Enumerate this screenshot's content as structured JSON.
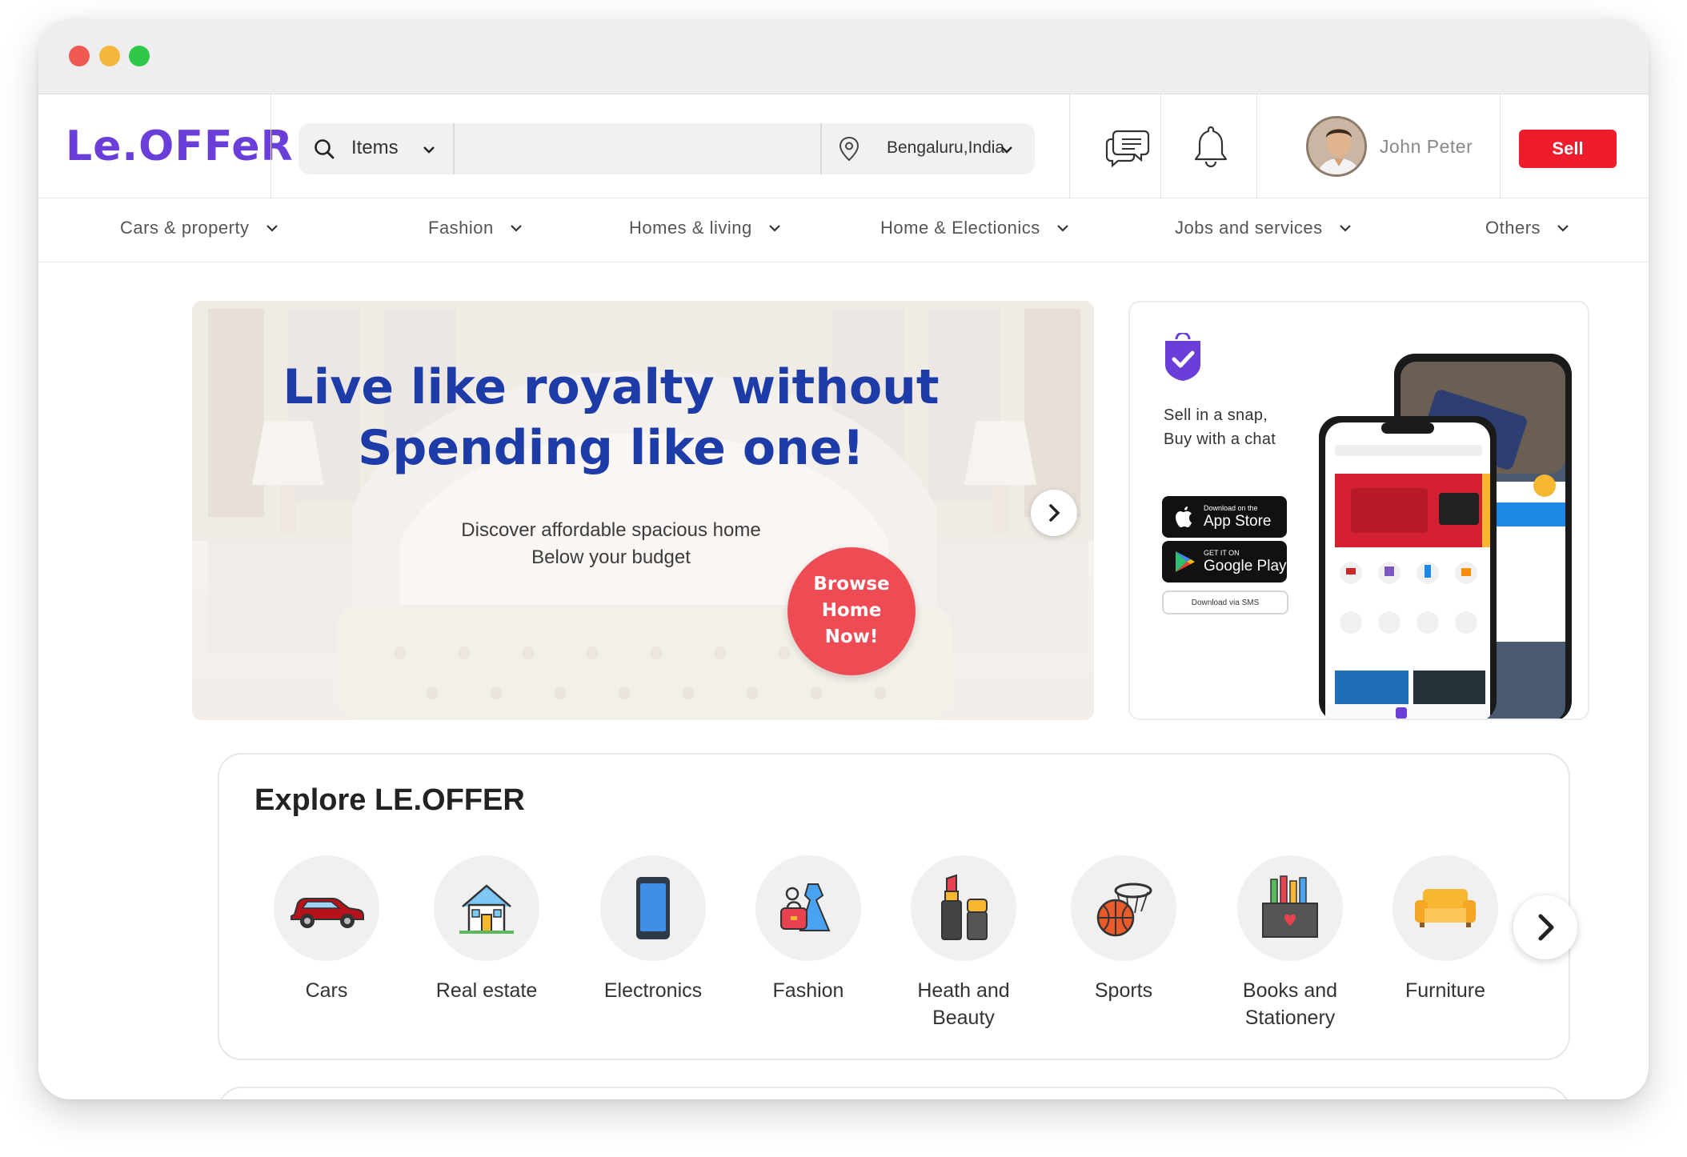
{
  "brand": {
    "logo_text": "Le.OFFeR",
    "color": "#6a3ed8"
  },
  "search": {
    "category": "Items",
    "query": "",
    "location": "Bengaluru,India"
  },
  "header": {
    "user_name": "John Peter",
    "sell_label": "Sell",
    "icons": [
      "chat-icon",
      "bell-icon"
    ]
  },
  "categories_nav": [
    {
      "label": "Cars & property"
    },
    {
      "label": "Fashion"
    },
    {
      "label": "Homes & living"
    },
    {
      "label": "Home & Electionics"
    },
    {
      "label": "Jobs and services"
    },
    {
      "label": "Others"
    }
  ],
  "hero": {
    "title_line1": "Live like royalty without",
    "title_line2": "Spending like one!",
    "subtitle_line1": "Discover affordable spacious home",
    "subtitle_line2": "Below your budget",
    "cta_line1": "Browse",
    "cta_line2": "Home",
    "cta_line3": "Now!",
    "title_color": "#1e3ca8",
    "cta_color": "#ef4b55"
  },
  "promo": {
    "tagline_line1": "Sell in a snap,",
    "tagline_line2": "Buy with a chat",
    "app_store_small": "Download on the",
    "app_store_big": "App Store",
    "google_play_small": "GET IT ON",
    "google_play_big": "Google Play",
    "sms_label": "Download via SMS"
  },
  "explore": {
    "title": "Explore LE.OFFER",
    "items": [
      {
        "label": "Cars",
        "icon": "car-icon"
      },
      {
        "label": "Real estate",
        "icon": "house-icon"
      },
      {
        "label": "Electronics",
        "icon": "phone-icon"
      },
      {
        "label": "Fashion",
        "icon": "dress-icon"
      },
      {
        "label": "Heath and Beauty",
        "icon": "lipstick-icon"
      },
      {
        "label": "Sports",
        "icon": "basketball-icon"
      },
      {
        "label": "Books and Stationery",
        "icon": "pencil-box-icon"
      },
      {
        "label": "Furniture",
        "icon": "sofa-icon"
      }
    ]
  }
}
